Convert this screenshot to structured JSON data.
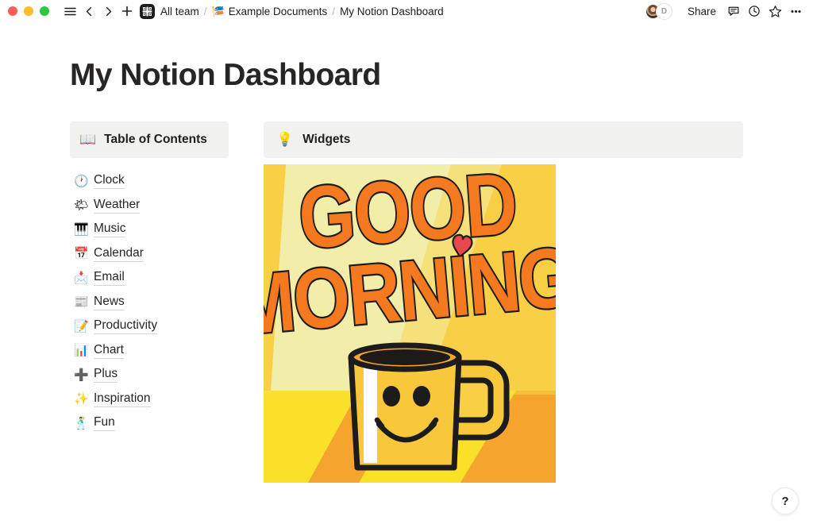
{
  "window": {
    "traffic_lights": [
      "close",
      "minimize",
      "maximize"
    ],
    "colors": {
      "close": "#FF5F57",
      "minimize": "#FEBC2E",
      "maximize": "#28C840"
    }
  },
  "toolbar": {
    "menu_icon": "hamburger-menu-icon",
    "back_icon": "chevron-left-icon",
    "forward_icon": "chevron-right-icon",
    "new_icon": "plus-icon",
    "workspace_icon": "workspace-grid-icon",
    "breadcrumb": [
      {
        "label": "All team",
        "emoji": ""
      },
      {
        "label": "Example Documents",
        "emoji": "🎏"
      },
      {
        "label": "My Notion Dashboard",
        "emoji": ""
      }
    ],
    "separator": "/",
    "avatars": [
      {
        "type": "photo",
        "initial": ""
      },
      {
        "type": "letter",
        "initial": "D"
      }
    ],
    "share_label": "Share",
    "comment_icon": "comment-icon",
    "history_icon": "clock-history-icon",
    "favorite_icon": "star-icon",
    "more_icon": "more-horizontal-icon"
  },
  "page": {
    "title": "My Notion Dashboard"
  },
  "toc": {
    "emoji": "📖",
    "heading": "Table of Contents",
    "items": [
      {
        "emoji": "🕐",
        "label": "Clock"
      },
      {
        "emoji": "🌤",
        "label": "Weather"
      },
      {
        "emoji": "🎹",
        "label": "Music"
      },
      {
        "emoji": "📅",
        "label": "Calendar"
      },
      {
        "emoji": "📩",
        "label": "Email"
      },
      {
        "emoji": "📰",
        "label": "News"
      },
      {
        "emoji": "📝",
        "label": "Productivity"
      },
      {
        "emoji": "📊",
        "label": "Chart"
      },
      {
        "emoji": "➕",
        "label": "Plus"
      },
      {
        "emoji": "✨",
        "label": "Inspiration"
      },
      {
        "emoji": "🕺",
        "label": "Fun"
      }
    ]
  },
  "widgets": {
    "emoji": "💡",
    "heading": "Widgets",
    "image": {
      "alt": "Good Morning illustration with smiling coffee mug",
      "text_line1": "GOOD",
      "text_line2": "MORNING",
      "background_color": "#F8CF45",
      "beam_color": "#F2EDA8",
      "text_color": "#F4791F",
      "heart_color": "#E8474B",
      "mug_color": "#F9C83A",
      "floor_colors": [
        "#F5A52E",
        "#FAE028"
      ]
    }
  },
  "help": {
    "label": "?"
  }
}
